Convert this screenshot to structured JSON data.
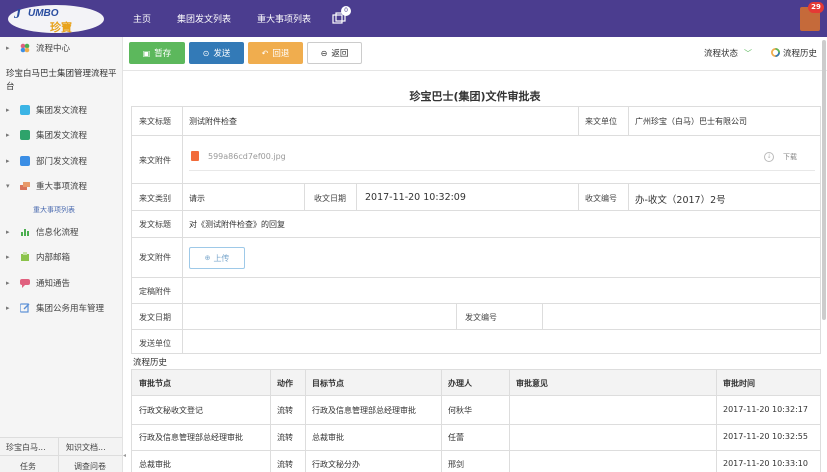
{
  "app": {
    "logo_text": "JUMBO",
    "logo_sub": "珍寶",
    "nav": [
      "主页",
      "集团发文列表",
      "重大事项列表"
    ],
    "nav_icon_badge": "0",
    "user_badge": "29"
  },
  "sidebar": {
    "top_item": "流程中心",
    "org_title": "珍宝白马巴士集团管理流程平台",
    "items": [
      {
        "label": "集团发文流程",
        "icon": "doc-icon",
        "color": "#3bb4e5"
      },
      {
        "label": "集团发文流程",
        "icon": "doc-icon",
        "color": "#2ea36b"
      },
      {
        "label": "部门发文流程",
        "icon": "doc-icon",
        "color": "#3b8ee5"
      },
      {
        "label": "重大事项流程",
        "icon": "stack-icon",
        "color": "#d9735a"
      },
      {
        "label": "信息化流程",
        "icon": "chart-icon",
        "color": "#4caf50"
      },
      {
        "label": "内部邮箱",
        "icon": "mailbox-icon",
        "color": "#8bc34a"
      },
      {
        "label": "通知通告",
        "icon": "chat-icon",
        "color": "#e0607e"
      },
      {
        "label": "集团公务用车管理",
        "icon": "edit-icon",
        "color": "#5b8fd6"
      }
    ],
    "sub_item": "重大事项列表",
    "bottom": {
      "cell1": "珍宝白马...",
      "cell2": "知识文档...",
      "cell3": "任务",
      "cell4": "调查问卷"
    }
  },
  "toolbar": {
    "save": "暂存",
    "send": "发送",
    "back": "回退",
    "return": "返回",
    "flow_status": "流程状态",
    "flow_history": "流程历史"
  },
  "doc": {
    "title": "珍宝巴士(集团)文件审批表",
    "labels": {
      "incoming_title": "来文标题",
      "incoming_unit": "来文单位",
      "incoming_attachment": "来文附件",
      "incoming_category": "来文类别",
      "receive_date": "收文日期",
      "receive_no": "收文编号",
      "outgoing_title": "发文标题",
      "outgoing_attachment": "发文附件",
      "final_attachment": "定稿附件",
      "outgoing_date": "发文日期",
      "outgoing_no": "发文编号",
      "outgoing_unit": "发送单位"
    },
    "values": {
      "incoming_title": "测试附件检查",
      "incoming_unit": "广州珍宝（白马）巴士有限公司",
      "attachment_file": "599a86cd7ef00.jpg",
      "download": "下载",
      "incoming_category": "请示",
      "receive_date": "2017-11-20 10:32:09",
      "receive_no": "办-收文（2017）2号",
      "outgoing_title": "对《测试附件检查》的回复",
      "upload": "上传"
    }
  },
  "history": {
    "caption": "流程历史",
    "headers": [
      "审批节点",
      "动作",
      "目标节点",
      "办理人",
      "审批意见",
      "审批时间"
    ],
    "rows": [
      [
        "行政文秘收文登记",
        "流转",
        "行政及信息管理部总经理审批",
        "何秋华",
        "",
        "2017-11-20 10:32:17"
      ],
      [
        "行政及信息管理部总经理审批",
        "流转",
        "总裁审批",
        "任蕾",
        "",
        "2017-11-20 10:32:55"
      ],
      [
        "总裁审批",
        "流转",
        "行政文秘分办",
        "邢剑",
        "",
        "2017-11-20 10:33:10"
      ]
    ]
  }
}
